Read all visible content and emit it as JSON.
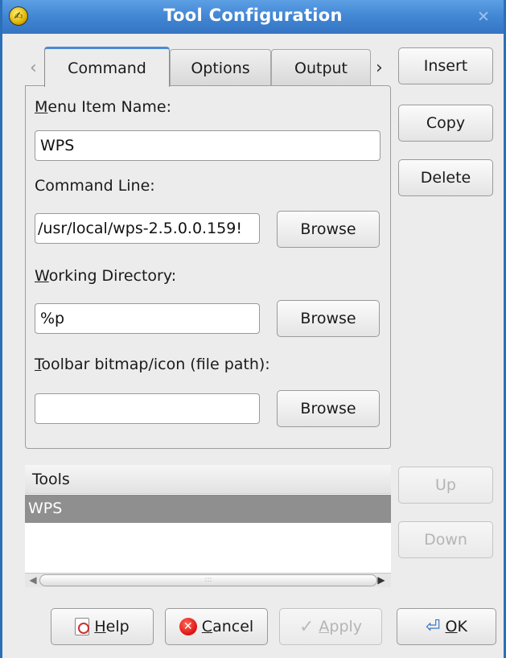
{
  "window": {
    "title": "Tool Configuration",
    "close_glyph": "✕",
    "app_icon_glyph": "✍"
  },
  "tabs": [
    {
      "label": "Command",
      "active": true
    },
    {
      "label": "Options",
      "active": false
    },
    {
      "label": "Output",
      "active": false
    }
  ],
  "tab_arrows": {
    "left": "‹",
    "right": "›"
  },
  "command": {
    "menu_item_label_mnemonic": "M",
    "menu_item_label_rest": "enu Item Name:",
    "menu_item_value": "WPS",
    "command_line_label": "Command Line:",
    "command_line_value": "/usr/local/wps-2.5.0.0.159!",
    "working_dir_label_mnemonic": "W",
    "working_dir_label_rest": "orking Directory:",
    "working_dir_value": "%p",
    "toolbar_icon_label_mnemonic": "T",
    "toolbar_icon_label_rest": "oolbar bitmap/icon (file path):",
    "toolbar_icon_value": "",
    "browse_label": "Browse"
  },
  "side_buttons": {
    "insert": "Insert",
    "copy": "Copy",
    "delete": "Delete",
    "up": "Up",
    "down": "Down"
  },
  "tools_list": {
    "header": "Tools",
    "items": [
      "WPS"
    ],
    "scroll_grip": ":::"
  },
  "footer_buttons": {
    "help_mnemonic": "H",
    "help_rest": "elp",
    "cancel_mnemonic": "C",
    "cancel_rest": "ancel",
    "apply_mnemonic": "A",
    "apply_rest": "pply",
    "ok_mnemonic": "O",
    "ok_rest": "K"
  },
  "icons": {
    "help": "help-icon",
    "cancel": "cancel-icon",
    "apply": "checkmark-icon",
    "ok": "enter-arrow-icon"
  },
  "colors": {
    "titlebar": "#3f84d2",
    "selected_row": "#8f8f8f",
    "active_tab_accent": "#4b8bd4"
  }
}
